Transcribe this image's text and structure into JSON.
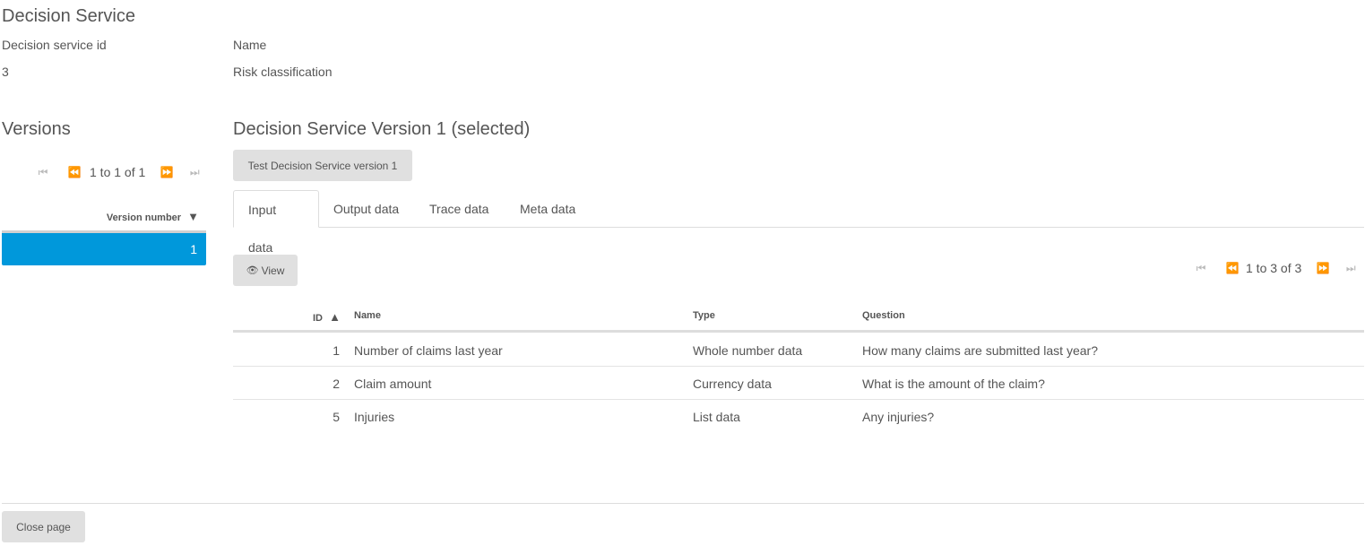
{
  "page": {
    "title": "Decision Service",
    "close_label": "Close page"
  },
  "service": {
    "id_label": "Decision service id",
    "id_value": "3",
    "name_label": "Name",
    "name_value": "Risk classification"
  },
  "versions": {
    "heading": "Versions",
    "pager_text": "1 to 1 of 1",
    "column_header": "Version number",
    "sort_indicator": "▼",
    "rows": [
      "1"
    ],
    "selected_color": "#0098db"
  },
  "detail": {
    "heading": "Decision Service Version 1 (selected)",
    "test_button": "Test Decision Service version 1",
    "tabs": [
      {
        "label": "Input data",
        "active": true
      },
      {
        "label": "Output data",
        "active": false
      },
      {
        "label": "Trace data",
        "active": false
      },
      {
        "label": "Meta data",
        "active": false
      }
    ],
    "view_button": "View",
    "view_icon": "eye-icon",
    "pager_text": "1 to 3 of 3"
  },
  "table": {
    "headers": {
      "id": "ID",
      "id_sort": "▲",
      "name": "Name",
      "type": "Type",
      "question": "Question"
    },
    "rows": [
      {
        "id": "1",
        "name": "Number of claims last year",
        "type": "Whole number data",
        "question": "How many claims are submitted last year?"
      },
      {
        "id": "2",
        "name": "Claim amount",
        "type": "Currency data",
        "question": "What is the amount of the claim?"
      },
      {
        "id": "5",
        "name": "Injuries",
        "type": "List data",
        "question": "Any injuries?"
      }
    ]
  }
}
